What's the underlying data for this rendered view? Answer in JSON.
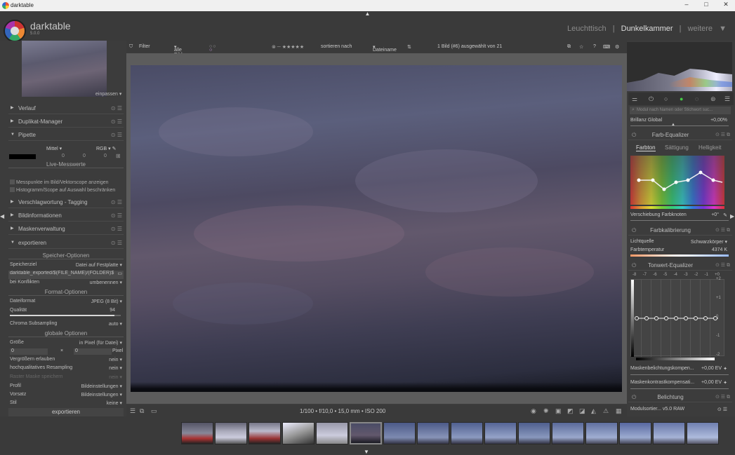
{
  "window": {
    "title": "darktable",
    "minimize": "–",
    "maximize": "□",
    "close": "✕"
  },
  "header": {
    "brand": "darktable",
    "version": "5.0.0",
    "views": [
      "Leuchttisch",
      "|",
      "Dunkelkammer",
      "|",
      "weitere"
    ],
    "active_view": "Dunkelkammer",
    "more_arrow": "▼",
    "top_arrow": "▲"
  },
  "left": {
    "fit_label": "einpassen ▾",
    "modules": [
      {
        "label": "Verlauf",
        "expanded": false
      },
      {
        "label": "Duplikat-Manager",
        "expanded": false
      },
      {
        "label": "Pipette",
        "expanded": true
      },
      {
        "label": "Verschlagwortung - Tagging",
        "expanded": false
      },
      {
        "label": "Bildinformationen",
        "expanded": false
      },
      {
        "label": "Maskenverwaltung",
        "expanded": false
      },
      {
        "label": "exportieren",
        "expanded": true
      }
    ],
    "pipette": {
      "mode": "Mittel",
      "space": "RGB",
      "values": [
        "0",
        "0",
        "0"
      ],
      "live": "Live-Messwerte",
      "check1": "Messpunkte im Bild/Vektorscope anzeigen",
      "check2": "Histogramm/Scope auf Auswahl beschränken"
    },
    "export": {
      "storage_title": "Speicher-Optionen",
      "storage_label": "Speicherziel",
      "storage_value": "Datei auf Festplatte",
      "path": "$(FOLDER)/darktable_exported/$(FILE_NAME)",
      "conflict_label": "bei Konflikten",
      "conflict_value": "umbenennen",
      "format_title": "Format-Optionen",
      "format_label": "Dateiformat",
      "format_value": "JPEG (8 Bit)",
      "quality_label": "Qualität",
      "quality_value": "94",
      "quality_pct": 94,
      "chroma_label": "Chroma Subsampling",
      "chroma_value": "auto",
      "global_title": "globale Optionen",
      "size_label": "Größe",
      "size_value": "in Pixel (für Datei)",
      "size_w": "0",
      "size_x": "×",
      "size_h": "0",
      "size_unit": "Pixel",
      "upscale_label": "Vergrößern erlauben",
      "upscale_value": "nein",
      "hq_label": "hochqualitatives Resampling",
      "hq_value": "nein",
      "raster_label": "Raster Maske speichern",
      "raster_value": "nein",
      "profile_label": "Profil",
      "profile_value": "Bildeinstellungen",
      "intent_label": "Vorsatz",
      "intent_value": "Bildeinstellungen",
      "style_label": "Stil",
      "style_value": "keine",
      "export_button": "exportieren"
    }
  },
  "filterbar": {
    "filter_label": "Filter",
    "filter_value": "alle Bilder",
    "sort_label": "sortieren nach",
    "sort_value": "Dateiname",
    "count": "1 Bild (#6) ausgewählt von 21"
  },
  "bottombar": {
    "exif": "1/100 • f/10,0 • 15,0 mm • ISO 200"
  },
  "right": {
    "search_placeholder": "Modul nach Namen oder Stichwort suc...",
    "brilliance_label": "Brillanz Global",
    "brilliance_value": "+0,00%",
    "color_eq": {
      "title": "Farb-Equalizer",
      "tabs": [
        "Farbton",
        "Sättigung",
        "Helligkeit"
      ],
      "shift_label": "Verschiebung Farbknoten",
      "shift_value": "+0°"
    },
    "calibration": {
      "title": "Farbkalibrierung",
      "illum_label": "Lichtquelle",
      "illum_value": "Schwarzkörper",
      "temp_label": "Farbtemperatur",
      "temp_value": "4374 K"
    },
    "tone_eq": {
      "title": "Tonwert-Equalizer",
      "ev_labels": [
        "-8",
        "-7",
        "-6",
        "-5",
        "-4",
        "-3",
        "-2",
        "-1",
        "+0"
      ],
      "y_labels": [
        "+2",
        "+1",
        "0",
        "-1",
        "-2"
      ]
    },
    "mask_exp_label": "Maskenbelichtungskompen...",
    "mask_exp_value": "+0,00 EV",
    "mask_con_label": "Maskenkontrastkompensati...",
    "mask_con_value": "+0,00 EV",
    "exposure_title": "Belichtung",
    "module_order": "Modulsortier... v5.0 RAW"
  },
  "filmstrip": {
    "count": 16,
    "selected_index": 5
  },
  "colors": {
    "accent": "#3c3c3c",
    "panel": "#3c3c3c",
    "text": "#c8c8c8"
  }
}
